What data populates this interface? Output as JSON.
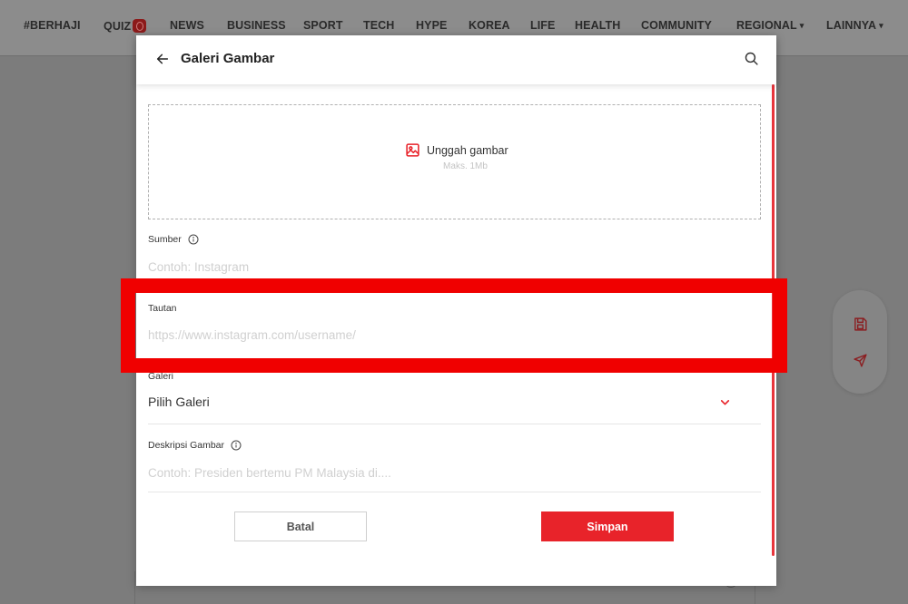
{
  "nav": {
    "items": [
      "#BERHAJI",
      "QUIZ",
      "NEWS",
      "BUSINESS",
      "SPORT",
      "TECH",
      "HYPE",
      "KOREA",
      "LIFE",
      "HEALTH",
      "COMMUNITY",
      "REGIONAL",
      "LAINNYA"
    ],
    "dropdown_caret": "▾"
  },
  "modal": {
    "title": "Galeri Gambar",
    "upload": {
      "label": "Unggah gambar",
      "hint": "Maks. 1Mb"
    },
    "source": {
      "label": "Sumber",
      "placeholder": "Contoh: Instagram"
    },
    "link": {
      "label": "Tautan",
      "placeholder": "https://www.instagram.com/username/"
    },
    "gallery": {
      "label": "Galeri",
      "value": "Pilih Galeri"
    },
    "description": {
      "label": "Deskripsi Gambar",
      "placeholder": "Contoh: Presiden bertemu PM Malaysia di...."
    },
    "cancel_label": "Batal",
    "save_label": "Simpan"
  },
  "colors": {
    "accent": "#e8232a",
    "highlight": "#f00000",
    "overlay": "#7c7c7c"
  },
  "icons": [
    "back-arrow-icon",
    "search-icon",
    "image-upload-icon",
    "info-icon",
    "chevron-down-icon",
    "save-icon",
    "send-icon"
  ]
}
